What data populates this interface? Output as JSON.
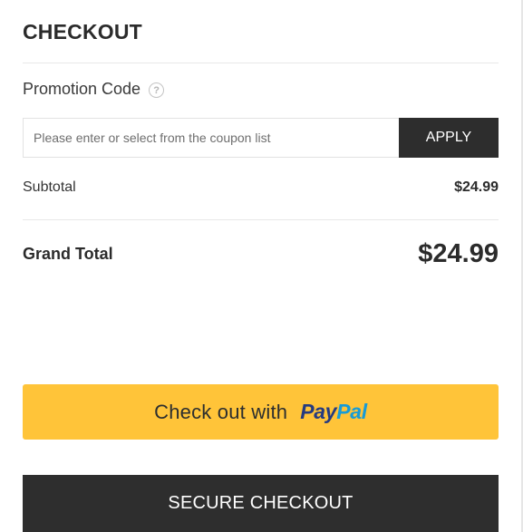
{
  "checkout": {
    "title": "CHECKOUT",
    "promotion": {
      "label": "Promotion Code",
      "help_icon": "question-circle-icon",
      "input_value": "",
      "input_placeholder": "Please enter or select from the coupon list",
      "apply_label": "APPLY"
    },
    "subtotal": {
      "label": "Subtotal",
      "value": "$24.99"
    },
    "grand_total": {
      "label": "Grand Total",
      "value": "$24.99"
    },
    "paypal": {
      "prefix": "Check out with",
      "logo_pay": "Pay",
      "logo_pal": "Pal",
      "button_color": "#ffc439"
    },
    "secure_checkout_label": "SECURE CHECKOUT"
  }
}
